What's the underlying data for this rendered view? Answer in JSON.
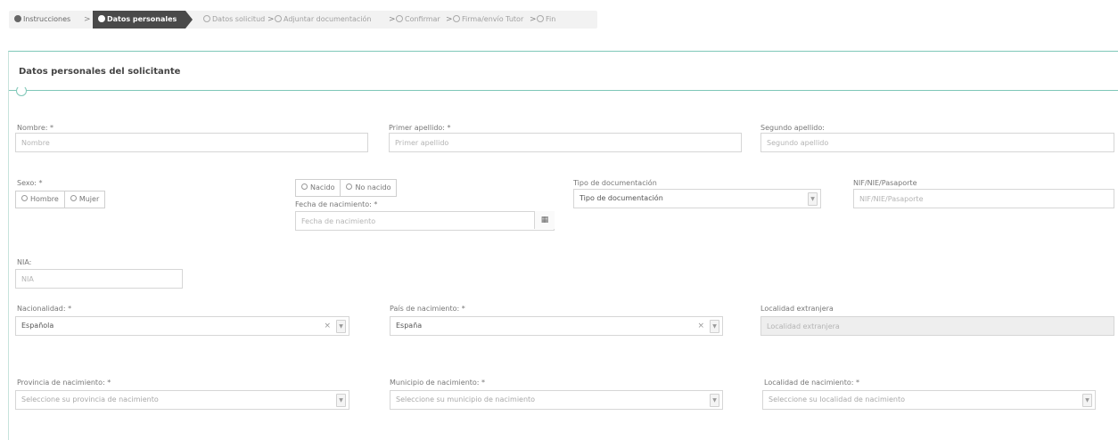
{
  "wizard": {
    "steps": [
      {
        "label": "Instrucciones",
        "state": "done"
      },
      {
        "label": "Datos personales",
        "state": "current"
      },
      {
        "label": "Datos solicitud",
        "state": "pending"
      },
      {
        "label": "Adjuntar documentación",
        "state": "pending"
      },
      {
        "label": "Confirmar",
        "state": "pending"
      },
      {
        "label": "Firma/envío Tutor",
        "state": "pending"
      },
      {
        "label": "Fin",
        "state": "pending"
      }
    ],
    "separator": ">"
  },
  "panel": {
    "title": "Datos personales del solicitante"
  },
  "form": {
    "nombre": {
      "label": "Nombre: *",
      "placeholder": "Nombre",
      "value": ""
    },
    "primer_apellido": {
      "label": "Primer apellido: *",
      "placeholder": "Primer apellido",
      "value": ""
    },
    "segundo_apellido": {
      "label": "Segundo apellido:",
      "placeholder": "Segundo apellido",
      "value": ""
    },
    "sexo": {
      "label": "Sexo: *",
      "options": [
        "Hombre",
        "Mujer"
      ]
    },
    "nacido": {
      "options": [
        "Nacido",
        "No nacido"
      ]
    },
    "fecha_nacimiento": {
      "label": "Fecha de nacimiento: *",
      "placeholder": "Fecha de nacimiento",
      "value": ""
    },
    "tipo_documentacion": {
      "label": "Tipo de documentación",
      "selected": "Tipo de documentación"
    },
    "nif": {
      "label": "NIF/NIE/Pasaporte",
      "placeholder": "NIF/NIE/Pasaporte",
      "value": ""
    },
    "nia": {
      "label": "NIA:",
      "placeholder": "NIA",
      "value": ""
    },
    "nacionalidad": {
      "label": "Nacionalidad: *",
      "selected": "Española"
    },
    "pais_nacimiento": {
      "label": "País de nacimiento: *",
      "selected": "España"
    },
    "localidad_extranjera": {
      "label": "Localidad extranjera",
      "placeholder": "Localidad extranjera",
      "value": ""
    },
    "provincia_nacimiento": {
      "label": "Provincia de nacimiento: *",
      "selected": "Seleccione su provincia de nacimiento"
    },
    "municipio_nacimiento": {
      "label": "Municipio de nacimiento: *",
      "selected": "Seleccione su municipio de nacimiento"
    },
    "localidad_nacimiento": {
      "label": "Localidad de nacimiento: *",
      "selected": "Seleccione su localidad de nacimiento"
    }
  },
  "icons": {
    "calendar": "calendar-icon",
    "dropdown": "chevron-down-icon",
    "clear": "clear-icon"
  },
  "colors": {
    "accent": "#7fc7b8",
    "current_step_bg": "#4a4a4a",
    "disabled_bg": "#eeeeee"
  }
}
